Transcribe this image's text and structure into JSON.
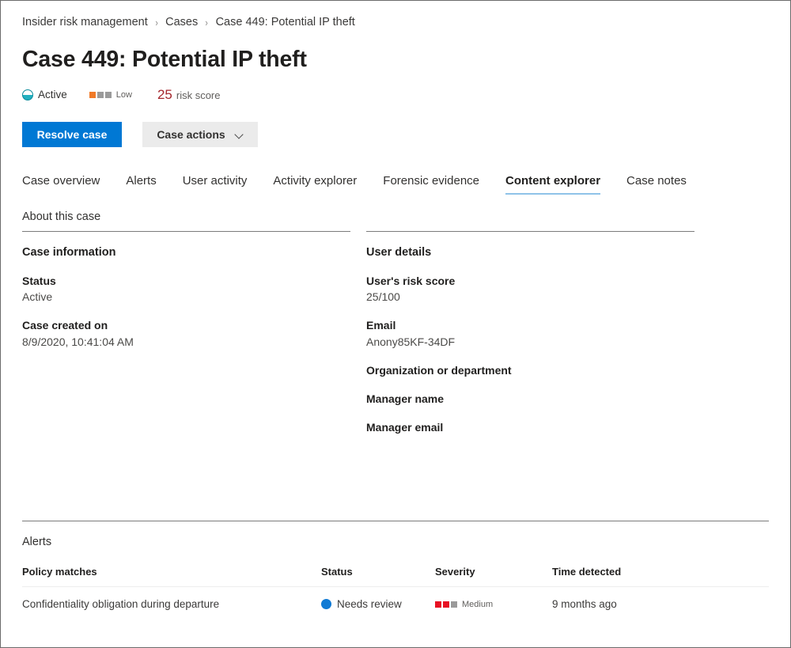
{
  "breadcrumb": {
    "items": [
      {
        "label": "Insider risk management"
      },
      {
        "label": "Cases"
      },
      {
        "label": "Case 449: Potential IP theft"
      }
    ],
    "separator": "›"
  },
  "page_title": "Case 449: Potential IP theft",
  "status_row": {
    "state": {
      "icon": "half-filled-circle-icon",
      "label": "Active",
      "color": "#22b0c0"
    },
    "severity": {
      "icon": "severity-squares-icon",
      "label": "Low",
      "filled": 1,
      "total": 3,
      "color": "#f07a28"
    },
    "risk": {
      "score": "25",
      "label": "risk score",
      "color": "#a4262c"
    }
  },
  "toolbar": {
    "resolve_label": "Resolve case",
    "case_actions_label": "Case actions",
    "case_actions_icon": "chevron-down-icon",
    "primary_color": "#0078d4",
    "secondary_color": "#ebebeb"
  },
  "tabs": {
    "active": "Content explorer",
    "underline_color": "#8fc3e8",
    "items": [
      {
        "label": "Case overview"
      },
      {
        "label": "Alerts"
      },
      {
        "label": "User activity"
      },
      {
        "label": "Activity explorer"
      },
      {
        "label": "Forensic evidence"
      },
      {
        "label": "Content explorer"
      },
      {
        "label": "Case notes"
      }
    ]
  },
  "about": {
    "heading": "About this case",
    "left": {
      "section_title": "Case information",
      "fields": [
        {
          "label": "Status",
          "value": "Active"
        },
        {
          "label": "Case created on",
          "value": "8/9/2020, 10:41:04 AM"
        }
      ]
    },
    "right": {
      "section_title": "User details",
      "fields": [
        {
          "label": "User's risk score",
          "value": "25/100"
        },
        {
          "label": "Email",
          "value": "Anony85KF-34DF"
        },
        {
          "label": "Organization or department",
          "value": ""
        },
        {
          "label": "Manager name",
          "value": ""
        },
        {
          "label": "Manager email",
          "value": ""
        }
      ]
    }
  },
  "alerts": {
    "title": "Alerts",
    "columns": [
      {
        "label": "Policy matches"
      },
      {
        "label": "Status"
      },
      {
        "label": "Severity"
      },
      {
        "label": "Time detected"
      }
    ],
    "rows": [
      {
        "policy": "Confidentiality obligation during departure",
        "status": {
          "icon": "status-dot-icon",
          "label": "Needs review",
          "color": "#0f7ad4"
        },
        "severity": {
          "icon": "severity-squares-icon",
          "label": "Medium",
          "filled": 2,
          "total": 3,
          "color": "#e81123"
        },
        "time": "9 months ago"
      }
    ]
  }
}
